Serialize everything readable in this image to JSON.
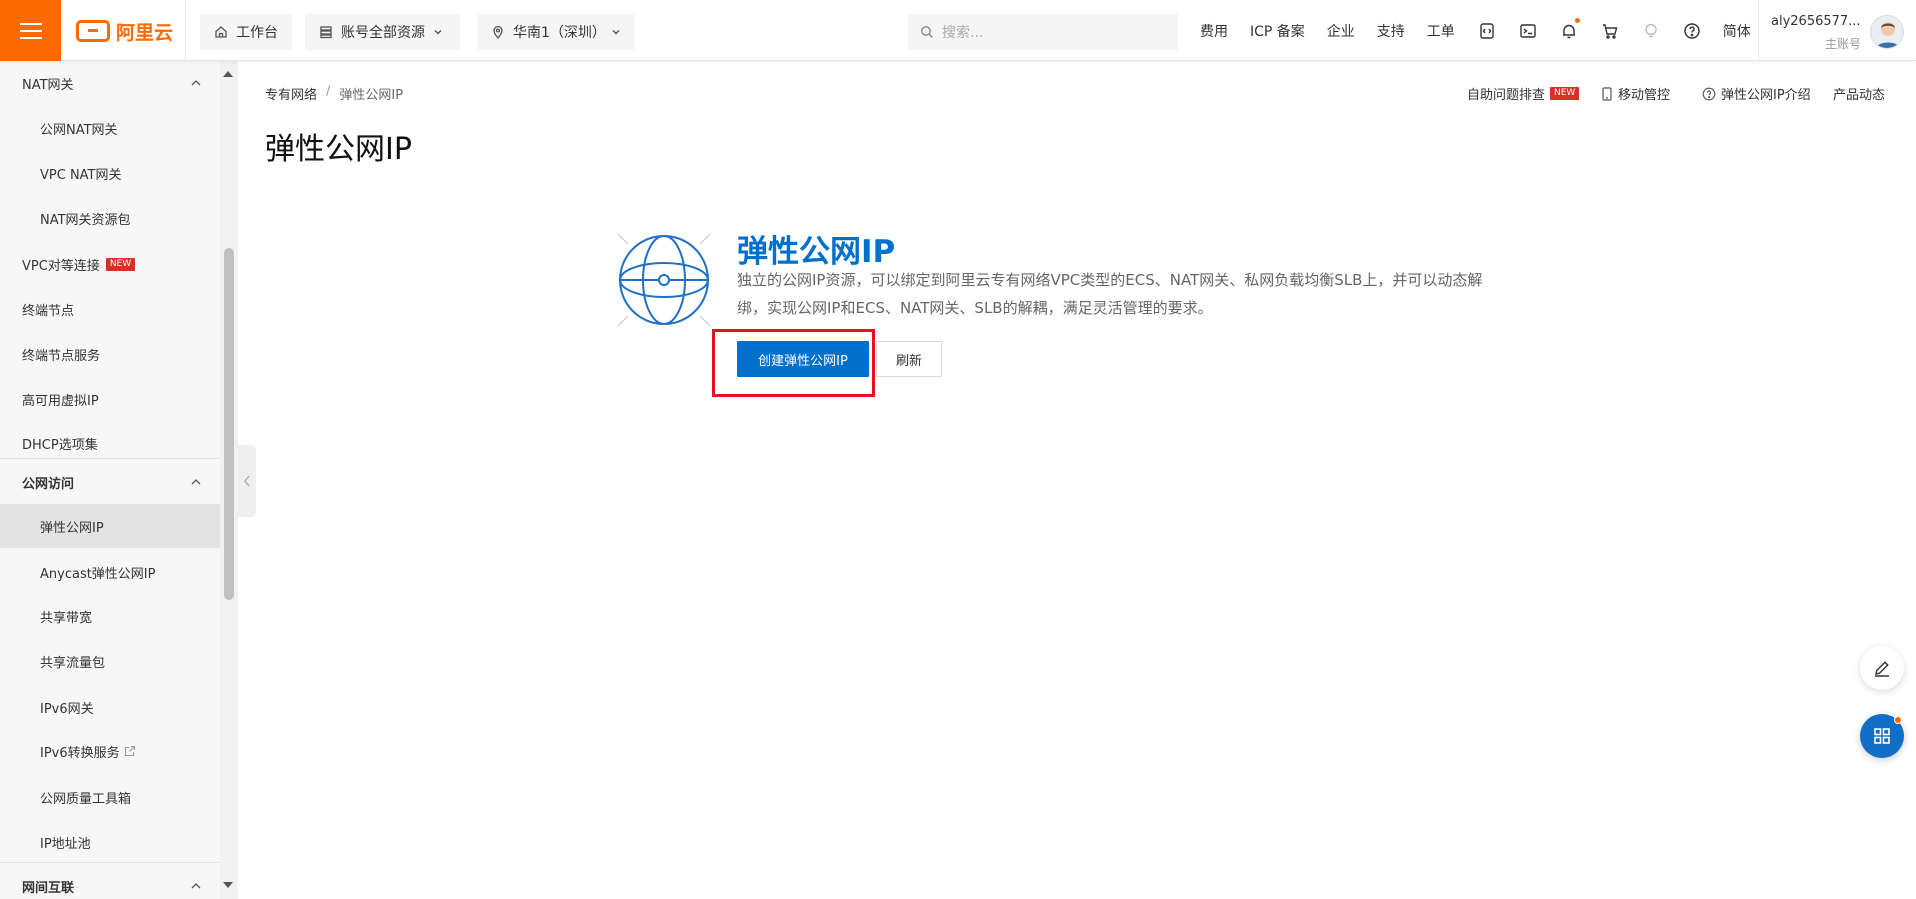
{
  "header": {
    "brand": "阿里云",
    "workbench": "工作台",
    "resources": "账号全部资源",
    "region": "华南1（深圳）",
    "search_placeholder": "搜索...",
    "links": [
      "费用",
      "ICP 备案",
      "企业",
      "支持",
      "工单"
    ],
    "lang": "简体",
    "account_name": "aly2656577...",
    "account_role": "主账号"
  },
  "sidebar": {
    "items": [
      {
        "label": "NAT网关"
      },
      {
        "label": "公网NAT网关"
      },
      {
        "label": "VPC NAT网关"
      },
      {
        "label": "NAT网关资源包"
      },
      {
        "label": "VPC对等连接",
        "badge": "NEW"
      },
      {
        "label": "终端节点"
      },
      {
        "label": "终端节点服务"
      },
      {
        "label": "高可用虚拟IP"
      },
      {
        "label": "DHCP选项集"
      },
      {
        "label": "公网访问"
      },
      {
        "label": "弹性公网IP"
      },
      {
        "label": "Anycast弹性公网IP"
      },
      {
        "label": "共享带宽"
      },
      {
        "label": "共享流量包"
      },
      {
        "label": "IPv6网关"
      },
      {
        "label": "IPv6转换服务"
      },
      {
        "label": "公网质量工具箱"
      },
      {
        "label": "IP地址池"
      },
      {
        "label": "网间互联"
      }
    ]
  },
  "breadcrumb": {
    "parent": "专有网络",
    "separator": "/",
    "current": "弹性公网IP"
  },
  "page_title": "弹性公网IP",
  "top_actions": {
    "self_help": "自助问题排查",
    "self_help_badge": "NEW",
    "mobile": "移动管控",
    "intro": "弹性公网IP介绍",
    "news": "产品动态"
  },
  "hero": {
    "title": "弹性公网IP",
    "description": "独立的公网IP资源，可以绑定到阿里云专有网络VPC类型的ECS、NAT网关、私网负载均衡SLB上，并可以动态解绑，实现公网IP和ECS、NAT网关、SLB的解耦，满足灵活管理的要求。",
    "create_button": "创建弹性公网IP",
    "refresh_button": "刷新"
  },
  "colors": {
    "brand": "#ff6a00",
    "primary": "#0070cc",
    "highlight": "#e5131f"
  }
}
